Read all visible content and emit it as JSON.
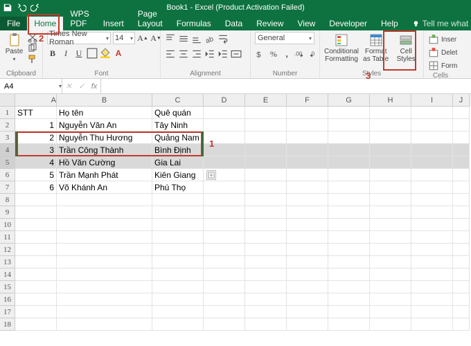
{
  "titlebar": {
    "title": "Book1 - Excel (Product Activation Failed)"
  },
  "tabs": {
    "file": "File",
    "home": "Home",
    "wpspdf": "WPS PDF",
    "insert": "Insert",
    "pagelayout": "Page Layout",
    "formulas": "Formulas",
    "data": "Data",
    "review": "Review",
    "view": "View",
    "developer": "Developer",
    "help": "Help",
    "tell": "Tell me what you want to do"
  },
  "ribbon": {
    "clipboard": {
      "paste": "Paste",
      "label": "Clipboard"
    },
    "font": {
      "name": "Times New Roman",
      "size": "14",
      "label": "Font"
    },
    "alignment": {
      "label": "Alignment"
    },
    "number": {
      "format": "General",
      "label": "Number"
    },
    "styles": {
      "conditional": "Conditional Formatting",
      "formatas": "Format as Table",
      "cell": "Cell Styles",
      "label": "Styles"
    },
    "cells": {
      "insert": "Inser",
      "delet": "Delet",
      "format": "Form",
      "label": "Cells"
    }
  },
  "formula_bar": {
    "name": "A4",
    "fx": "fx",
    "value": ""
  },
  "columns": [
    "A",
    "B",
    "C",
    "D",
    "E",
    "F",
    "G",
    "H",
    "I",
    "J"
  ],
  "rows_shown": 18,
  "sheet": {
    "header": {
      "stt": "STT",
      "hoten": "Họ tên",
      "quequan": "Quê quán"
    },
    "data": [
      {
        "stt": "1",
        "hoten": "Nguyễn Văn An",
        "quequan": "Tây Ninh"
      },
      {
        "stt": "2",
        "hoten": "Nguyễn Thu Hương",
        "quequan": "Quảng Nam"
      },
      {
        "stt": "3",
        "hoten": "Trần Công Thành",
        "quequan": "Bình Định"
      },
      {
        "stt": "4",
        "hoten": "Hồ Văn Cường",
        "quequan": "Gia Lai"
      },
      {
        "stt": "5",
        "hoten": "Trần Mạnh Phát",
        "quequan": "Kiên Giang"
      },
      {
        "stt": "6",
        "hoten": "Võ Khánh An",
        "quequan": "Phú Thọ"
      }
    ]
  },
  "annotations": {
    "a1": "1",
    "a2": "2",
    "a3": "3"
  }
}
